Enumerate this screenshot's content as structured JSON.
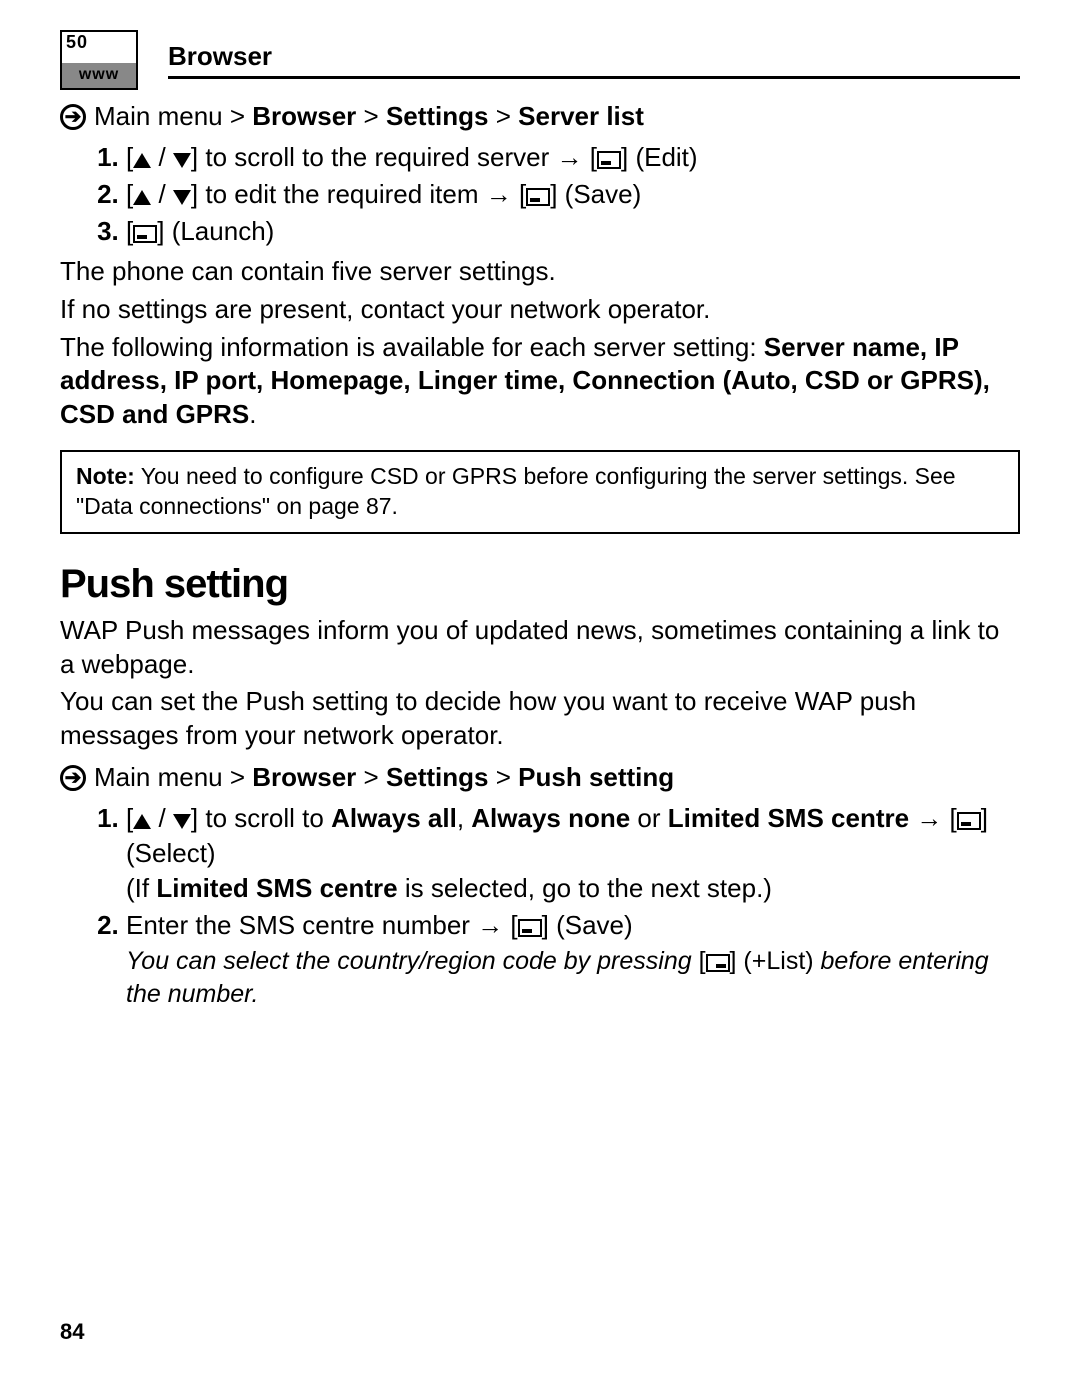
{
  "header": {
    "icon_top": "50",
    "icon_bottom": "www",
    "title": "Browser"
  },
  "bc1": {
    "prefix": "Main menu > ",
    "b1": "Browser",
    "sep1": " > ",
    "b2": "Settings",
    "sep2": " > ",
    "b3": "Server list"
  },
  "steps1": {
    "s1_mid": " to scroll to the required server ",
    "s1_act": " (Edit)",
    "s2_mid": " to edit the required item ",
    "s2_act": " (Save)",
    "s3_act": " (Launch)"
  },
  "p1": "The phone can contain five server settings.",
  "p2": "If no settings are present, contact your network operator.",
  "p3_a": "The following information is available for each server setting: ",
  "p3_bold": "Server name, IP address, IP port, Homepage, Linger time, Connection (Auto, CSD or GPRS), CSD and GPRS",
  "p3_tail": ".",
  "note_bold": "Note:",
  "note_text": " You need to configure CSD or GPRS before configuring the server settings. See \"Data connections\" on page 87.",
  "h2": "Push setting",
  "p4": "WAP Push messages inform you of updated news, sometimes containing a link to a webpage.",
  "p5": "You can set the Push setting to decide how you want to receive WAP push messages from your network operator.",
  "bc2": {
    "prefix": "Main menu > ",
    "b1": "Browser",
    "sep1": " > ",
    "b2": "Settings",
    "sep2": " > ",
    "b3": "Push setting"
  },
  "steps2": {
    "s1_a": " to scroll to ",
    "s1_b1": "Always all",
    "s1_b2": ", ",
    "s1_b3": "Always none",
    "s1_b4": " or ",
    "s1_b5": "Limited SMS centre",
    "s1_act": " (Select)",
    "s1_if_a": "(If ",
    "s1_if_b": "Limited SMS centre",
    "s1_if_c": " is selected, go to the next step.)",
    "s2_a": "Enter the SMS centre number ",
    "s2_act": " (Save)",
    "s2_it_a": "You can select the country/region code by pressing ",
    "s2_it_b": " (+List) ",
    "s2_it_c": "before entering the number."
  },
  "page_number": "84"
}
